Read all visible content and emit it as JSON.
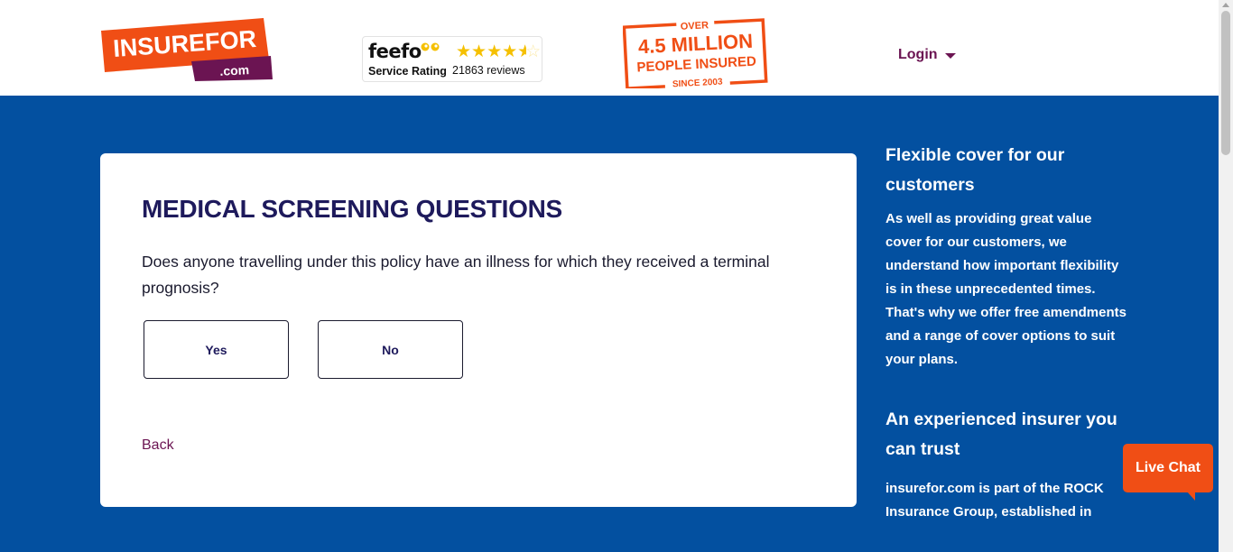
{
  "header": {
    "logo": {
      "main": "INSUREFOR",
      "sub": ".com"
    },
    "feefo": {
      "brand": "feefo",
      "label": "Service Rating",
      "reviews": "21863 reviews",
      "rating_stars": 4.5
    },
    "badge": {
      "top": "OVER",
      "line1": "4.5 MILLION",
      "line2": "PEOPLE INSURED",
      "bottom": "SINCE 2003"
    },
    "login_label": "Login"
  },
  "card": {
    "title": "MEDICAL SCREENING QUESTIONS",
    "question": "Does anyone travelling under this policy have an illness for which they received a terminal prognosis?",
    "yes_label": "Yes",
    "no_label": "No",
    "back_label": "Back"
  },
  "sidebar": {
    "heading1": "Flexible cover for our customers",
    "text1": "As well as providing great value cover for our customers, we understand how important flexibility is in these unprecedented times. That's why we offer free amendments and a range of cover options to suit your plans.",
    "heading2": "An experienced insurer you can trust",
    "text2": "insurefor.com is part of the ROCK Insurance Group, established in"
  },
  "live_chat_label": "Live Chat",
  "colors": {
    "background": "#0350a0",
    "accent_orange": "#f04e15",
    "brand_purple": "#6b1452",
    "title_navy": "#1e1a5c"
  }
}
